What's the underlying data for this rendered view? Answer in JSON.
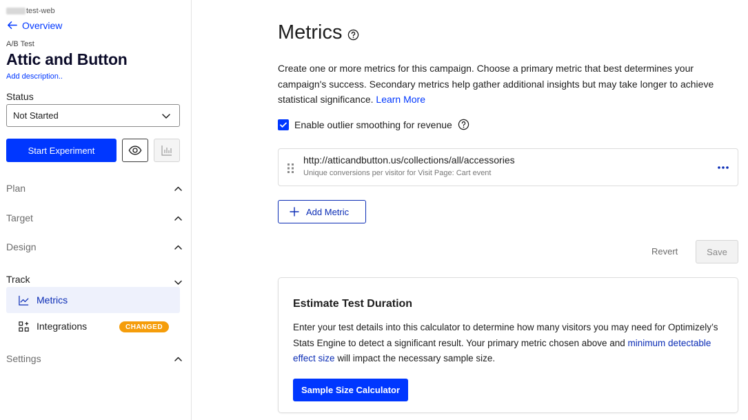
{
  "sidebar": {
    "project_name": "test-web",
    "back_label": "Overview",
    "experiment_type": "A/B Test",
    "experiment_title": "Attic and Button",
    "add_description": "Add description..",
    "status_label": "Status",
    "status_value": "Not Started",
    "start_button": "Start Experiment",
    "sections": {
      "plan": "Plan",
      "target": "Target",
      "design": "Design",
      "track": "Track",
      "settings": "Settings"
    },
    "track_items": {
      "metrics": "Metrics",
      "integrations": "Integrations",
      "integrations_badge": "CHANGED"
    }
  },
  "main": {
    "heading": "Metrics",
    "intro_text": "Create one or more metrics for this campaign. Choose a primary metric that best determines your campaign's success. Secondary metrics help gather additional insights but may take longer to achieve statistical significance.",
    "learn_more": "Learn More",
    "outlier_label": "Enable outlier smoothing for revenue",
    "outlier_checked": true,
    "metric": {
      "url": "http://atticandbutton.us/collections/all/accessories",
      "description": "Unique conversions per visitor for Visit Page: Cart event"
    },
    "add_metric": "Add Metric",
    "revert": "Revert",
    "save": "Save",
    "estimate": {
      "title": "Estimate Test Duration",
      "body_1": "Enter your test details into this calculator to determine how many visitors you may need for Optimizely’s Stats Engine to detect a significant result. Your primary metric chosen above and",
      "link": "minimum detectable effect size",
      "body_2": "will impact the necessary sample size.",
      "button": "Sample Size Calculator"
    }
  },
  "colors": {
    "primary": "#0037ff",
    "badge": "#f59d0b",
    "selected_bg": "#eef1fc"
  }
}
